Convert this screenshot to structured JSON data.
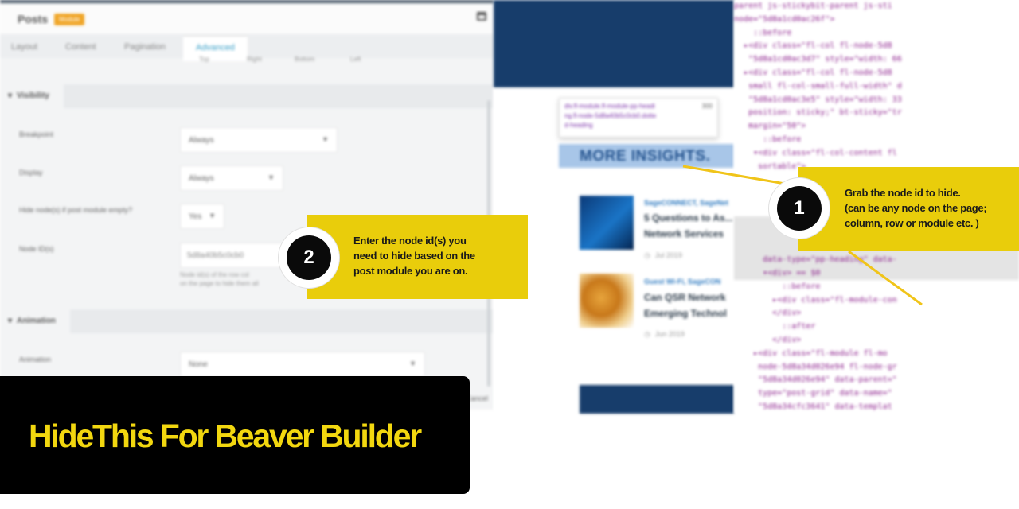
{
  "settings_panel": {
    "title": "Posts",
    "badge": "Module",
    "tabs": [
      "Layout",
      "Content",
      "Pagination",
      "Advanced"
    ],
    "active_tab": "Advanced",
    "tab_sublabels": [
      "Top",
      "Right",
      "Bottom",
      "Left"
    ],
    "visibility_section": {
      "title": "Visibility",
      "breakpoint": {
        "label": "Breakpoint",
        "value": "Always"
      },
      "display": {
        "label": "Display",
        "value": "Always"
      },
      "hide_nodes": {
        "label": "Hide node(s) if post module empty?",
        "value": "Yes"
      },
      "node_ids": {
        "label": "Node ID(s)",
        "value": "5d8a40b5c0cb0",
        "help_line1": "Node id(s) of the row col",
        "help_line2": "on the page to hide them all"
      }
    },
    "animation_section": {
      "title": "Animation",
      "animation": {
        "label": "Animation",
        "value": "None"
      }
    },
    "cancel_label": "Cancel"
  },
  "preview": {
    "tooltip_selector_line1": "div.fl-module.fl-module-pp-headi",
    "tooltip_selector_line2": "ng.fl-node-5d8a40b5c0cb0.dotte",
    "tooltip_selector_line3": "d-heading",
    "tooltip_size": "300",
    "highlight_text": "MORE INSIGHTS.",
    "posts": [
      {
        "category": "SageCONNECT, SageNet",
        "title_line1": "5 Questions to As...",
        "title_line2": "Network Services",
        "date": "Jul 2019"
      },
      {
        "category": "Guest Wi-Fi, SageCON",
        "title_line1": "Can QSR Network",
        "title_line2": "Emerging Technol",
        "date": "Jun 2019"
      }
    ]
  },
  "devtools_lines": [
    "parent js-stickybit-parent js-sti",
    "node=\"5d8a1cd0ac26f\">",
    "    ::before",
    "  ▸<div class=\"fl-col fl-node-5d8",
    "   \"5d8a1cd0ac3d7\" style=\"width: 66",
    "  ▸<div class=\"fl-col fl-node-5d8",
    "   small fl-col-small-full-width\" d",
    "   \"5d8a1cd0ac3e5\" style=\"width: 33",
    "   position: sticky;\" bt-sticky=\"tr",
    "   margin=\"50\">",
    "      ::before",
    "    ▾<div class=\"fl-col-content fl",
    "     sortable\">",
    "",
    "",
    "",
    "",
    "",
    "",
    "      data-type=\"pp-heading\" data-",
    "      ▾<div> == $0",
    "          ::before",
    "        ▸<div class=\"fl-module-con",
    "        </div>",
    "          ::after",
    "        </div>",
    "    ▸<div class=\"fl-module fl-mo",
    "     node-5d8a34d026e94 fl-node-gr",
    "     \"5d8a34d026e94\" data-parent=\"",
    "     type=\"post-grid\" data-name=\"",
    "     \"5d8a34cfc3641\" data-templat"
  ],
  "callouts": {
    "step1": {
      "number": "1",
      "line1": "Grab the node id to hide.",
      "line2": "(can be any node on the page;",
      "line3": "column, row or module etc. )"
    },
    "step2": {
      "number": "2",
      "line1": "Enter the node id(s)  you",
      "line2": "need to hide based on the",
      "line3": "post module you are on."
    }
  },
  "title": "HideThis For Beaver Builder",
  "colors": {
    "callout_yellow": "#e9cd0b",
    "title_yellow": "#f2d70f",
    "banner_black": "#000000",
    "preview_navy": "#173d6b",
    "highlight_blue": "#a8c6e8"
  }
}
